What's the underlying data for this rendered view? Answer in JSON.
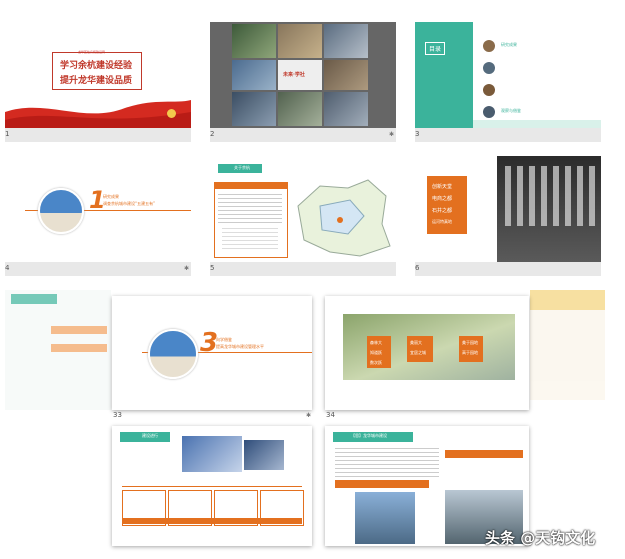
{
  "slides": [
    {
      "num": "1",
      "title_line1": "学习余杭建设经验",
      "title_line2": "提升龙华建设品质",
      "small": "龙华区住房和建设局"
    },
    {
      "num": "2",
      "logo": "未来·学社"
    },
    {
      "num": "3",
      "title": "目录",
      "items": [
        "研究成果",
        "",
        "",
        "观察与借鉴"
      ]
    },
    {
      "num": "4",
      "big": "1",
      "caption_line1": "研究成果",
      "caption_line2": "调查余杭城市建设“五建五有”"
    },
    {
      "num": "5",
      "heading": "关于余杭"
    },
    {
      "num": "6",
      "lines": [
        "创新天堂",
        "电商之都",
        "石井之都",
        "运河特真地"
      ]
    },
    {
      "num": "33",
      "big": "3",
      "caption_line1": "向学借鉴",
      "caption_line2": "提高龙华城市建设管理水平"
    },
    {
      "num": "34",
      "labels": [
        "森林大",
        "知道跃",
        "数次跃",
        "美丽大",
        "宜居之城",
        "美于园地",
        "高于园地"
      ]
    },
    {
      "num": "",
      "heading": "建设进行"
    },
    {
      "num": "",
      "heading": "【思】龙华城市建设"
    }
  ],
  "watermark": "头条 @天钩文化"
}
